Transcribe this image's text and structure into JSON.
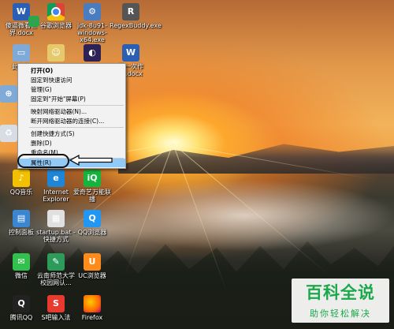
{
  "desktop_icons": [
    {
      "label": "傻逼微看世界.docx",
      "glyph": "W",
      "icon": "word-doc-icon"
    },
    {
      "label": "谷歌浏览器",
      "glyph": "",
      "icon": "chrome-icon"
    },
    {
      "label": "jdk-8u91-windows-x64.exe",
      "glyph": "⚙",
      "icon": "installer-icon"
    },
    {
      "label": "RegexBuddy.exe",
      "glyph": "R",
      "icon": "regexbuddy-icon"
    },
    {
      "label": "此电脑",
      "glyph": "▭",
      "icon": "computer-icon"
    },
    {
      "label": "",
      "glyph": "☺",
      "icon": "user-folder-icon"
    },
    {
      "label": "",
      "glyph": "◐",
      "icon": "eclipse-icon"
    },
    {
      "label": "第一次作业.docx",
      "glyph": "W",
      "icon": "word-doc-icon"
    },
    {
      "label": "网络",
      "glyph": "⊕",
      "icon": "network-icon"
    },
    {
      "label": "回收站",
      "glyph": "♻",
      "icon": "recycle-bin-icon"
    },
    {
      "label": "QQ音乐",
      "glyph": "♪",
      "icon": "qq-music-icon"
    },
    {
      "label": "Internet Explorer",
      "glyph": "e",
      "icon": "internet-explorer-icon"
    },
    {
      "label": "爱奇艺万能联播",
      "glyph": "iQ",
      "icon": "iqiyi-icon"
    },
    {
      "label": "控制面板",
      "glyph": "▤",
      "icon": "control-panel-icon"
    },
    {
      "label": "startup.bat - 快捷方式",
      "glyph": "▦",
      "icon": "bat-shortcut-icon"
    },
    {
      "label": "QQ浏览器",
      "glyph": "Q",
      "icon": "qq-browser-icon"
    },
    {
      "label": "微信",
      "glyph": "✉",
      "icon": "wechat-icon"
    },
    {
      "label": "云南师范大学校园网认...",
      "glyph": "✎",
      "icon": "campus-network-icon"
    },
    {
      "label": "UC浏览器",
      "glyph": "U",
      "icon": "uc-browser-icon"
    },
    {
      "label": "腾讯QQ",
      "glyph": "Q",
      "icon": "qq-icon"
    },
    {
      "label": "S吧输入法",
      "glyph": "S",
      "icon": "sogou-icon"
    },
    {
      "label": "Firefox",
      "glyph": "",
      "icon": "firefox-icon"
    }
  ],
  "context_menu": {
    "items": [
      {
        "label": "打开(O)",
        "bold": true
      },
      {
        "label": "固定到快速访问"
      },
      {
        "label": "管理(G)"
      },
      {
        "label": "固定到\"开始\"屏幕(P)"
      },
      {
        "label": "映射网络驱动器(N)..."
      },
      {
        "label": "断开网络驱动器的连接(C)..."
      },
      {
        "label": "创建快捷方式(S)"
      },
      {
        "label": "删除(D)"
      },
      {
        "label": "重命名(M)"
      },
      {
        "label": "属性(R)",
        "highlighted": true
      }
    ]
  },
  "watermark": {
    "title": "百科全说",
    "subtitle": "助你轻松解决"
  },
  "colors": {
    "menu_highlight": "#91c9f7",
    "watermark_green": "#1aa84a"
  }
}
